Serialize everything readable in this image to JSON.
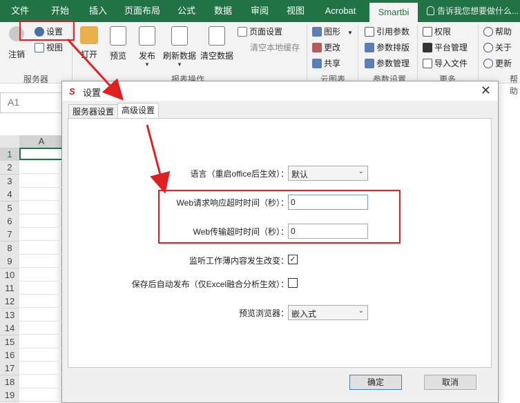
{
  "ribbon_tabs": [
    "文件",
    "开始",
    "插入",
    "页面布局",
    "公式",
    "数据",
    "审阅",
    "视图",
    "Acrobat",
    "Smartbi"
  ],
  "tell_me": "告诉我您想要做什么...",
  "ribbon": {
    "logout": "注销",
    "settings": "设置",
    "view": "视图",
    "open": "打开",
    "preview": "预览",
    "publish": "发布",
    "refresh_data": "刷新数据",
    "clear_data": "清空数据",
    "page_setup": "页面设置",
    "clear_cache": "清空本地缓存",
    "graphic": "图形",
    "change": "更改",
    "share": "共享",
    "ref_params": "引用参数",
    "param_layout": "参数排版",
    "param_manage": "参数管理",
    "permission": "权限",
    "platform_manage": "平台管理",
    "import_file": "导入文件",
    "help": "帮助",
    "about": "关于",
    "update": "更新",
    "groups": {
      "server": "服务器",
      "report_ops": "报表操作",
      "cloud_chart": "云图表",
      "param_settings": "参数设置",
      "more": "更多",
      "help": "帮助"
    }
  },
  "name_box": "A1",
  "column_header": "A",
  "row_numbers": [
    "1",
    "2",
    "3",
    "4",
    "5",
    "6",
    "7",
    "8",
    "9",
    "10",
    "11",
    "12",
    "13",
    "14",
    "15",
    "16",
    "17",
    "18",
    "19"
  ],
  "dialog": {
    "title": "设置",
    "close": "✕",
    "tabs": [
      "服务器设置",
      "高级设置"
    ],
    "fields": {
      "language_label": "语言（重启office后生效）：",
      "language_value": "默认",
      "web_timeout_label": "Web请求响应超时时间（秒）：",
      "web_timeout_value": "0",
      "web_transfer_label": "Web传输超时时间（秒）：",
      "web_transfer_value": "0",
      "monitor_label": "监听工作薄内容发生改变：",
      "monitor_checked": "✓",
      "autopublish_label": "保存后自动发布（仅Excel融合分析生效）：",
      "browser_label": "预览浏览器：",
      "browser_value": "嵌入式"
    },
    "ok": "确定",
    "cancel": "取消"
  },
  "colors": {
    "excel_green": "#217346",
    "annotation_red": "#e02020"
  }
}
